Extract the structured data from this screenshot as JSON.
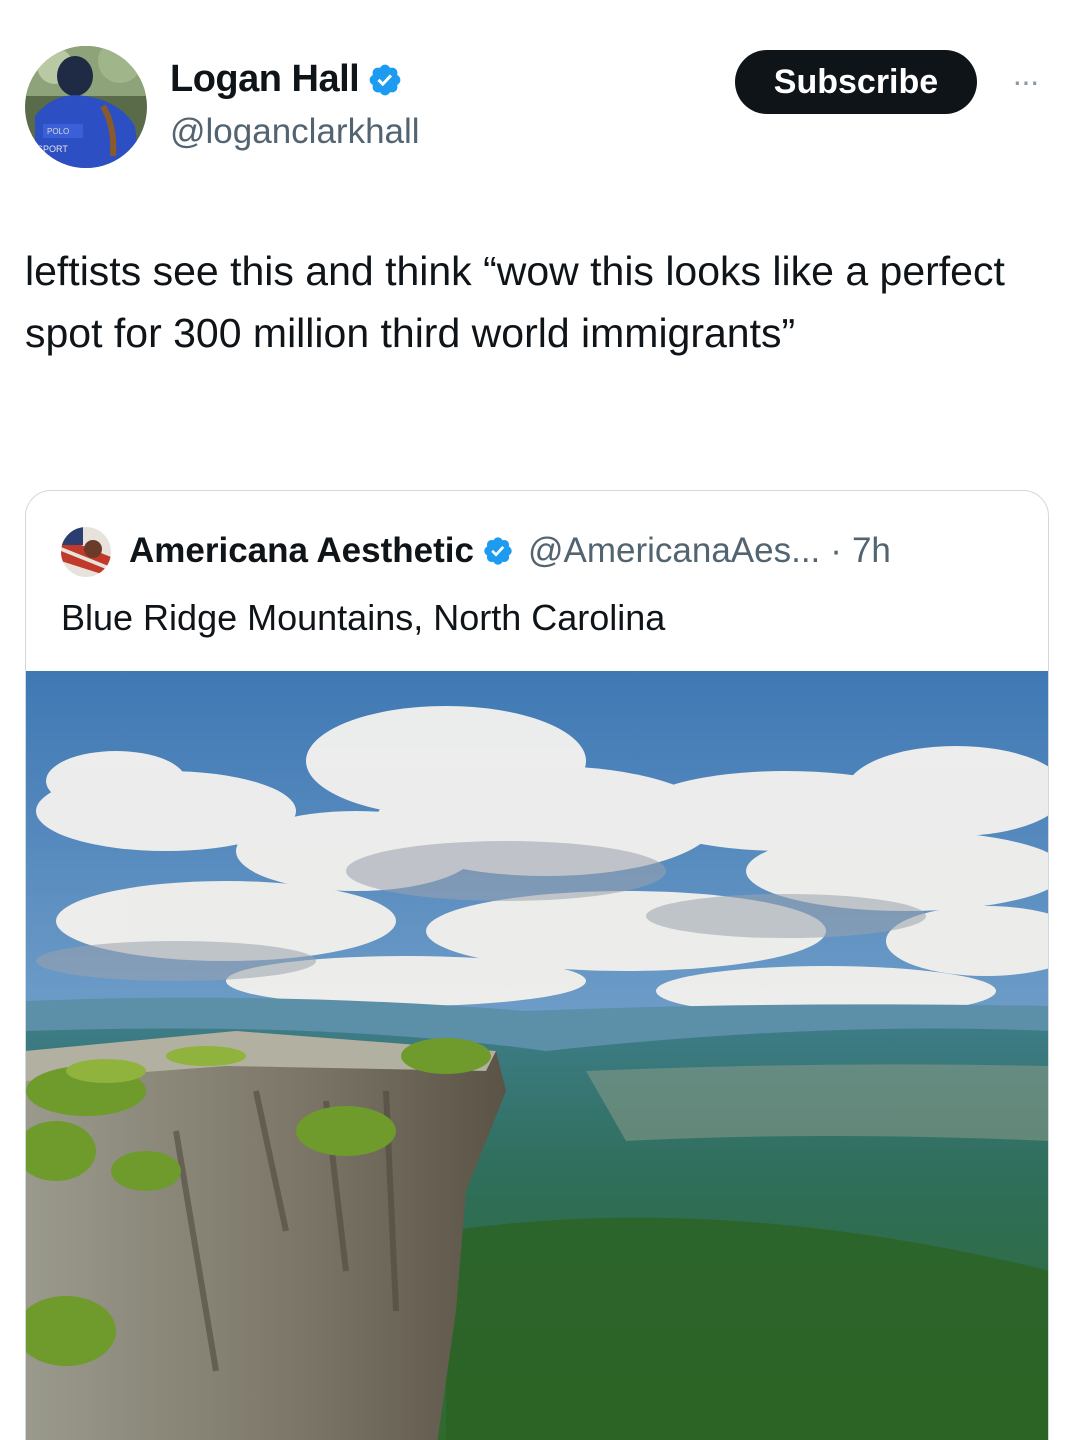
{
  "author": {
    "display_name": "Logan Hall",
    "handle": "@loganclarkhall",
    "verified": true
  },
  "header": {
    "subscribe_label": "Subscribe",
    "more_label": "···"
  },
  "tweet": {
    "text": "leftists see this and think “wow this looks like a perfect spot for 300 million third world immigrants”"
  },
  "quoted": {
    "display_name": "Americana Aesthetic",
    "handle": "@AmericanaAes...",
    "separator": "·",
    "time": "7h",
    "text": "Blue Ridge Mountains, North Carolina",
    "image_icon": "landscape-photo"
  },
  "colors": {
    "verified_blue": "#1d9bf0",
    "subscribe_bg": "#0f1419",
    "secondary_text": "#536471",
    "border": "#cfd9de"
  }
}
